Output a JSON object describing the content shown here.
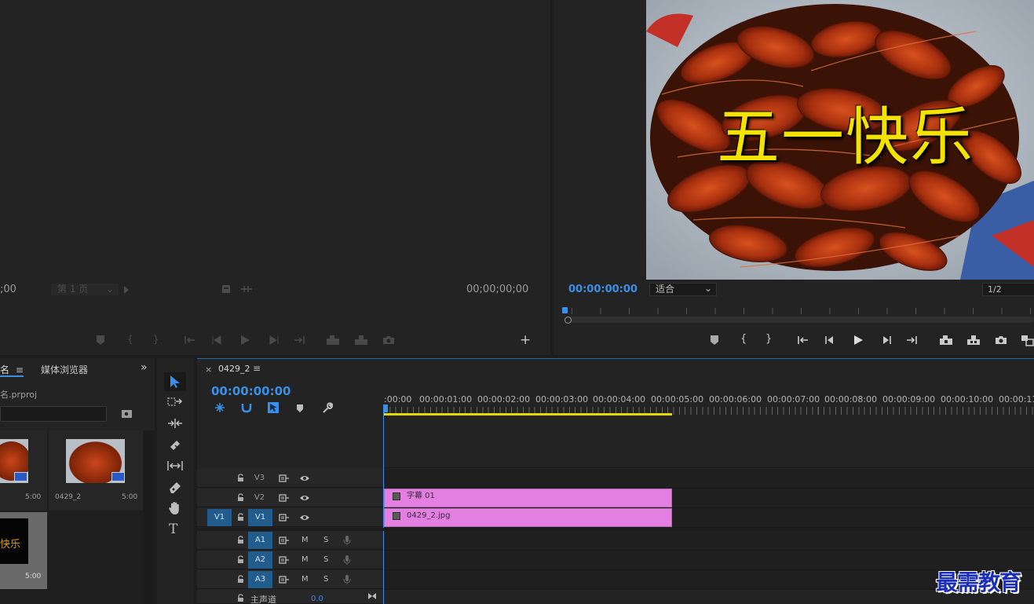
{
  "source_monitor": {
    "left_timecode": ";00",
    "page_select": "第 1 页",
    "right_timecode": "00;00;00;00"
  },
  "program_monitor": {
    "timecode": "00:00:00:00",
    "fit_select": "适合",
    "resolution_select": "1/2",
    "title_overlay": "五一快乐"
  },
  "project": {
    "tab_name": "名",
    "tab_media_browser": "媒体浏览器",
    "file_name": "名.prproj",
    "items": [
      {
        "name": "",
        "duration": "5:00"
      },
      {
        "name": "0429_2",
        "duration": "5:00"
      },
      {
        "name": "",
        "duration": "5:00",
        "label": "快乐"
      }
    ]
  },
  "timeline": {
    "sequence_name": "0429_2",
    "timecode": "00:00:00:00",
    "ruler": [
      ":00:00",
      "00:00:01:00",
      "00:00:02:00",
      "00:00:03:00",
      "00:00:04:00",
      "00:00:05:00",
      "00:00:06:00",
      "00:00:07:00",
      "00:00:08:00",
      "00:00:09:00",
      "00:00:10:00",
      "00:00:11:"
    ],
    "video_tracks": [
      "V3",
      "V2",
      "V1"
    ],
    "source_patch": "V1",
    "audio_tracks": [
      "A1",
      "A2",
      "A3"
    ],
    "mute_label": "M",
    "solo_label": "S",
    "master_label": "主声道",
    "master_value": "0.0",
    "clips": [
      {
        "track": "V2",
        "name": "字幕 01"
      },
      {
        "track": "V1",
        "name": "0429_2.jpg"
      }
    ]
  },
  "watermark": "最需教育",
  "colors": {
    "accent": "#3b8fe6",
    "clip": "#e27fe0",
    "track_on": "#215c8d",
    "work_area": "#e5d800"
  }
}
